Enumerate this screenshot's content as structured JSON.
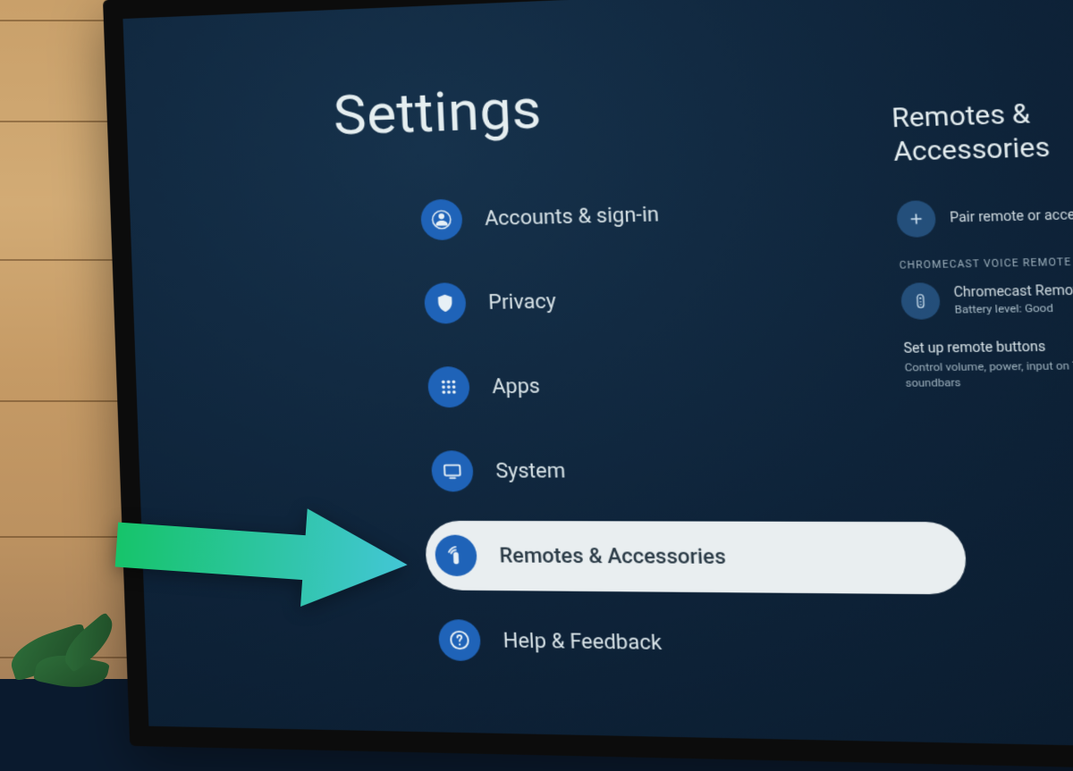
{
  "title": "Settings",
  "menu": {
    "items": [
      {
        "label": "Accounts & sign-in",
        "icon": "account"
      },
      {
        "label": "Privacy",
        "icon": "shield"
      },
      {
        "label": "Apps",
        "icon": "grid"
      },
      {
        "label": "System",
        "icon": "tv"
      },
      {
        "label": "Remotes & Accessories",
        "icon": "remote",
        "selected": true
      },
      {
        "label": "Help & Feedback",
        "icon": "help"
      }
    ]
  },
  "side": {
    "title": "Remotes & Accessories",
    "pair_label": "Pair remote or accessory",
    "section_header": "CHROMECAST VOICE REMOTE",
    "device": {
      "name": "Chromecast Remote",
      "status": "Battery level: Good"
    },
    "setup": {
      "title": "Set up remote buttons",
      "desc": "Control volume, power, input on TVs, receivers and soundbars"
    }
  },
  "colors": {
    "accent": "#1f63b8",
    "arrow_start": "#16c46a",
    "arrow_end": "#43c6d6"
  }
}
